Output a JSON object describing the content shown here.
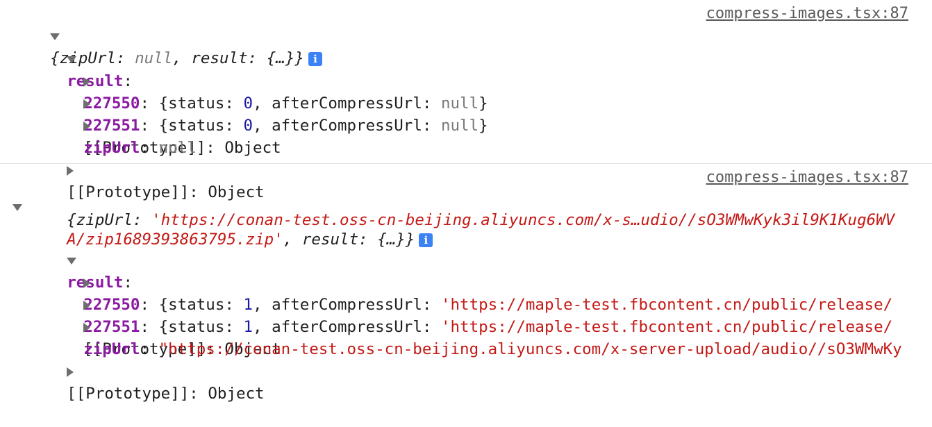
{
  "entries": [
    {
      "source": "compress-images.tsx:87",
      "summary": {
        "open": "{",
        "zip_key": "zipUrl",
        "colon": ": ",
        "zip_value": "null",
        "comma": ", ",
        "result_key": "result",
        "result_value": "{…}",
        "close": "}"
      },
      "result_label": "result",
      "items": [
        {
          "id": "227550",
          "status": "0",
          "after": "null"
        },
        {
          "id": "227551",
          "status": "0",
          "after": "null"
        }
      ],
      "inner_prototype": "[[Prototype]]: Object",
      "zip_label": "zipUrl",
      "zip_value": "null",
      "outer_prototype": "[[Prototype]]: Object"
    },
    {
      "source": "compress-images.tsx:87",
      "summary_line1_prefix": "{",
      "summary_line1_key": "zipUrl",
      "summary_line1_colon": ": ",
      "summary_line1_str": "'https://conan-test.oss-cn-beijing.aliyuncs.com/x-s…udio//sO3WMwKyk3il9K1Kug6WV",
      "summary_line2_str": "A/zip1689393863795.zip'",
      "summary_line2_comma": ", ",
      "summary_line2_key": "result",
      "summary_line2_colon": ": ",
      "summary_line2_value": "{…}",
      "summary_line2_close": "}",
      "result_label": "result",
      "items": [
        {
          "id": "227550",
          "status": "1",
          "after": "'https://maple-test.fbcontent.cn/public/release/"
        },
        {
          "id": "227551",
          "status": "1",
          "after": "'https://maple-test.fbcontent.cn/public/release/"
        }
      ],
      "inner_prototype": "[[Prototype]]: Object",
      "zip_label": "zipUrl",
      "zip_value": "\"https://conan-test.oss-cn-beijing.aliyuncs.com/x-server-upload/audio//sO3WMwKy",
      "outer_prototype": "[[Prototype]]: Object"
    }
  ],
  "labels": {
    "status_key": "status",
    "after_key": "afterCompressUrl",
    "colon": ": ",
    "open": "{",
    "close": "}",
    "comma": ", "
  },
  "icons": {
    "info": "info-icon",
    "expand": "triangle-down-icon",
    "collapse": "triangle-right-icon"
  },
  "colors": {
    "key": "#8b1aa2",
    "string": "#c41a16",
    "number": "#1a1aa6",
    "null": "#7a7a7a",
    "info": "#3b82f6"
  }
}
